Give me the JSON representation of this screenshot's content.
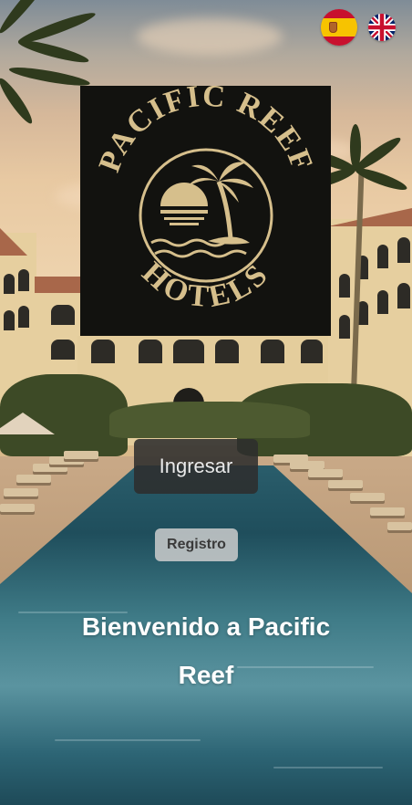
{
  "languages": [
    {
      "code": "es",
      "icon": "spain-flag-icon"
    },
    {
      "code": "en",
      "icon": "uk-flag-icon"
    }
  ],
  "logo": {
    "top_text": "PACIFIC REEF",
    "bottom_text": "HOTELS",
    "icon": "sunset-palm-emblem-icon",
    "colors": {
      "background": "#12120f",
      "gold": "#d6bf8c"
    }
  },
  "actions": {
    "login_label": "Ingresar",
    "register_label": "Registro"
  },
  "welcome": {
    "line1": "Bienvenido a Pacific",
    "line2": "Reef"
  },
  "colors": {
    "login_button": "#2d2d2d",
    "register_button": "#cdcdcd",
    "welcome_text": "#ffffff"
  }
}
